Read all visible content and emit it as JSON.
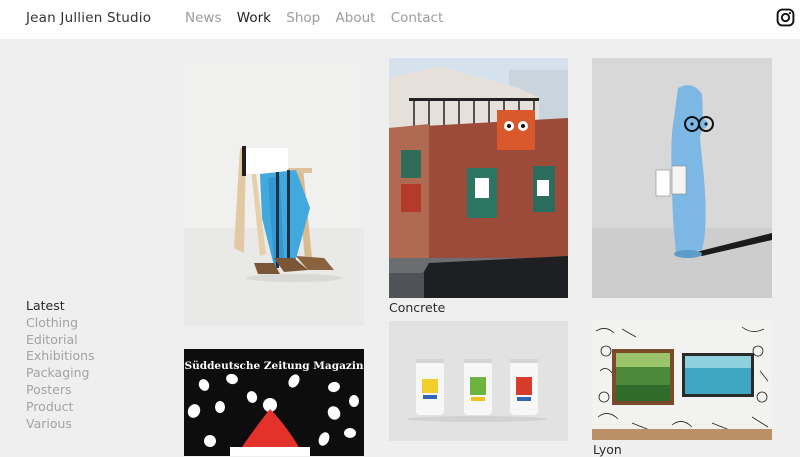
{
  "header": {
    "brand": "Jean Jullien Studio",
    "nav": [
      {
        "label": "News"
      },
      {
        "label": "Work",
        "active": true
      },
      {
        "label": "Shop"
      },
      {
        "label": "About"
      },
      {
        "label": "Contact"
      }
    ],
    "social_icon": "instagram-icon"
  },
  "sidebar": {
    "items": [
      {
        "label": "Latest",
        "active": true
      },
      {
        "label": "Clothing"
      },
      {
        "label": "Editorial"
      },
      {
        "label": "Exhibitions"
      },
      {
        "label": "Packaging"
      },
      {
        "label": "Posters"
      },
      {
        "label": "Product"
      },
      {
        "label": "Various"
      }
    ]
  },
  "grid": {
    "tiles": [
      {
        "caption": "",
        "image": "chair-with-blue-fabric"
      },
      {
        "caption": "Concrete",
        "image": "brick-building-with-murals"
      },
      {
        "caption": "",
        "image": "blue-dog-figure-with-glasses"
      },
      {
        "caption": "",
        "image": "magazine-cover-santa-hat",
        "cover_title": "Süddeutsche Zeitung Magazin"
      },
      {
        "caption": "",
        "image": "three-illustrated-cans"
      },
      {
        "caption": "Lyon",
        "image": "illustrated-wall-with-paintings"
      }
    ]
  },
  "colors": {
    "background": "#efefef",
    "header_bg": "#ffffff",
    "nav_inactive": "#9c9c9c",
    "nav_active": "#222222",
    "accent_blue": "#42a9df"
  }
}
